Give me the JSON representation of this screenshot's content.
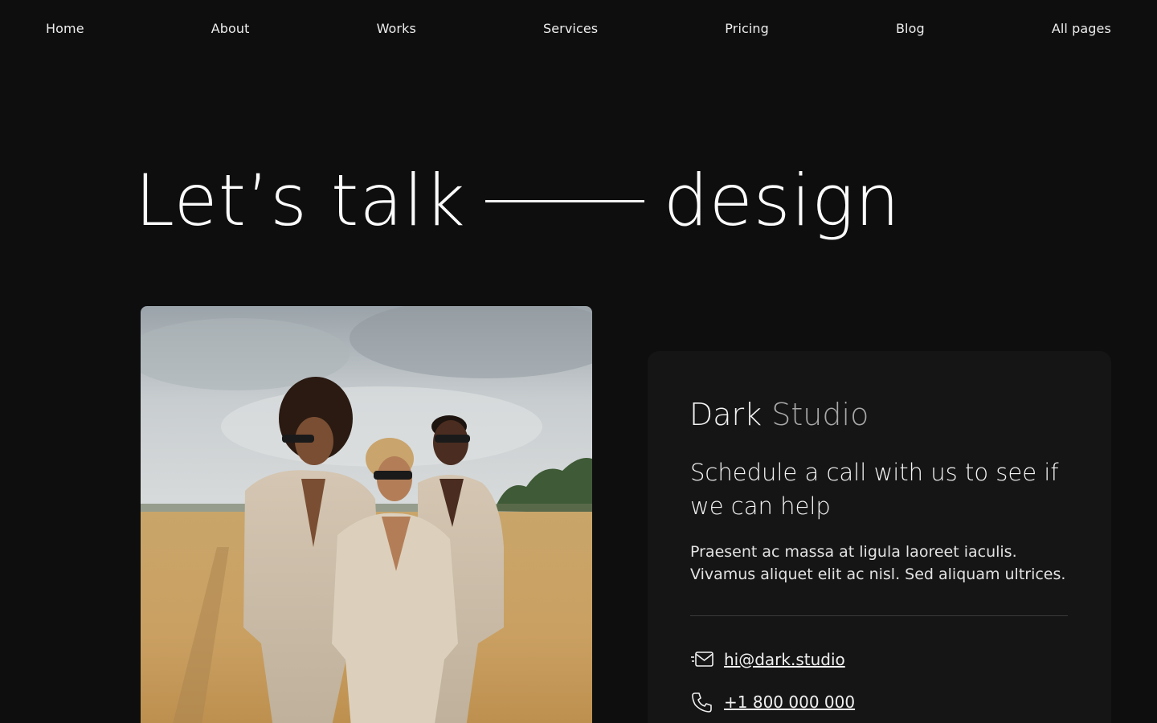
{
  "nav": {
    "items": [
      "Home",
      "About",
      "Works",
      "Services",
      "Pricing",
      "Blog",
      "All pages"
    ]
  },
  "hero": {
    "left_word": "Let’s talk",
    "right_word": "design"
  },
  "card": {
    "brand_primary": "Dark",
    "brand_secondary": "Studio",
    "headline": "Schedule a call with us to see if we can help",
    "description_line1": "Praesent ac massa at ligula laoreet iaculis.",
    "description_line2": "Vivamus aliquet elit ac nisl. Sed aliquam ultrices.",
    "email": "hi@dark.studio",
    "phone": "+1 800 000 000",
    "email_icon": "mail-icon",
    "phone_icon": "phone-icon"
  },
  "colors": {
    "background": "#0e0e0e",
    "card": "#151515",
    "text": "#f2f2f2",
    "muted": "#a8a8a8"
  }
}
